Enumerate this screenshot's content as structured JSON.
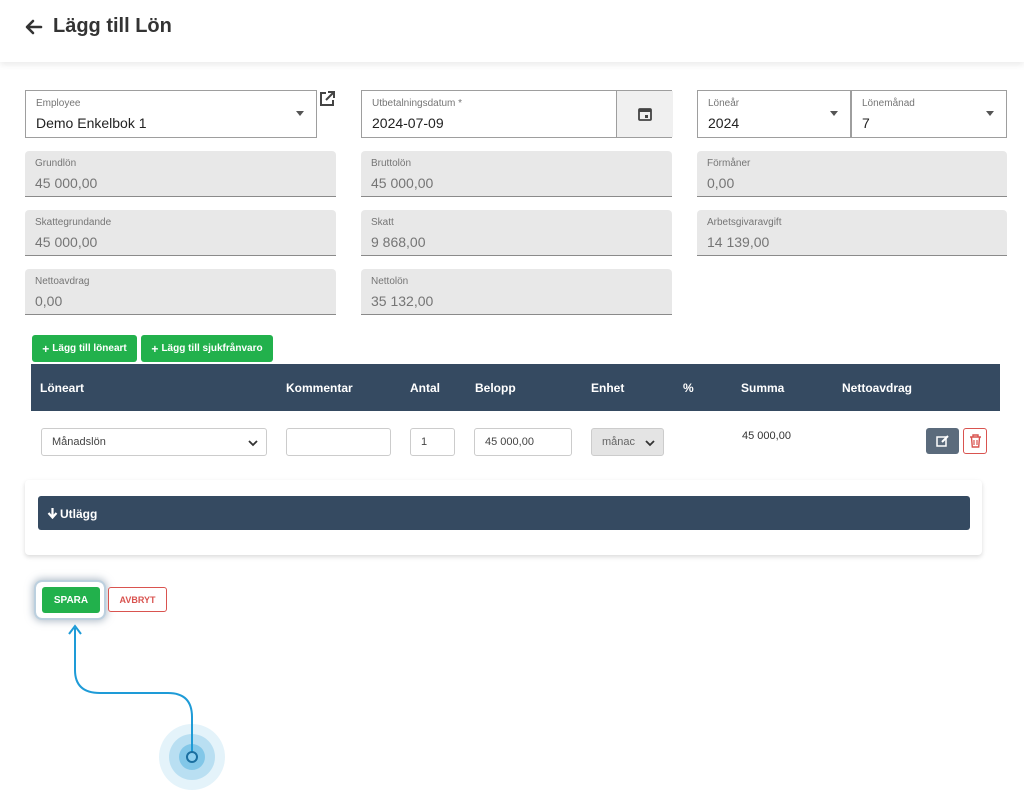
{
  "header": {
    "title": "Lägg till Lön"
  },
  "form": {
    "employee": {
      "label": "Employee",
      "value": "Demo Enkelbok 1"
    },
    "payment_date": {
      "label": "Utbetalningsdatum *",
      "value": "2024-07-09"
    },
    "salary_year": {
      "label": "Löneår",
      "value": "2024"
    },
    "salary_month": {
      "label": "Lönemånad",
      "value": "7"
    },
    "summary": [
      {
        "label": "Grundlön",
        "value": "45 000,00"
      },
      {
        "label": "Bruttolön",
        "value": "45 000,00"
      },
      {
        "label": "Förmåner",
        "value": "0,00"
      },
      {
        "label": "Skattegrundande",
        "value": "45 000,00"
      },
      {
        "label": "Skatt",
        "value": "9 868,00"
      },
      {
        "label": "Arbetsgivaravgift",
        "value": "14 139,00"
      },
      {
        "label": "Nettoavdrag",
        "value": "0,00"
      },
      {
        "label": "Nettolön",
        "value": "35 132,00"
      }
    ]
  },
  "actions": {
    "add_salary_type": "Lägg till löneart",
    "add_sick_leave": "Lägg till sjukfrånvaro"
  },
  "table": {
    "columns": [
      "Löneart",
      "Kommentar",
      "Antal",
      "Belopp",
      "Enhet",
      "%",
      "Summa",
      "Nettoavdrag"
    ],
    "row": {
      "type": "Månadslön",
      "comment": "",
      "quantity": "1",
      "amount": "45 000,00",
      "unit": "månac",
      "sum": "45 000,00"
    }
  },
  "utlagg": {
    "label": "Utlägg"
  },
  "footer": {
    "save": "SPARA",
    "cancel": "AVBRYT"
  },
  "colors": {
    "green": "#22b14c",
    "navy": "#354a61",
    "red": "#d9534f",
    "edit_btn": "#5b6b7c",
    "pointer": "#1e9bd7"
  },
  "icons": {
    "back": "arrow-left-icon",
    "external": "external-link-icon",
    "calendar": "calendar-icon",
    "edit": "edit-icon",
    "delete": "trash-icon",
    "down": "arrow-down-icon"
  }
}
